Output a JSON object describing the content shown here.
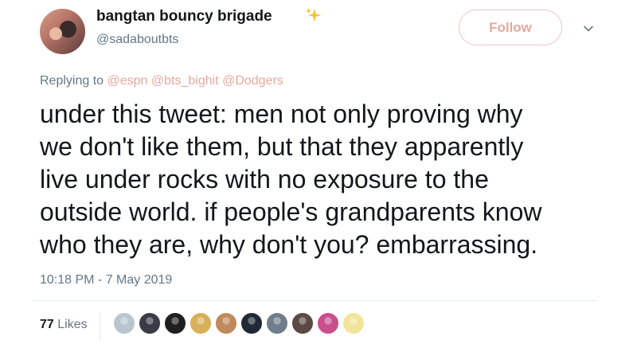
{
  "author": {
    "name": "bangtan bouncy brigade",
    "handle": "@sadaboutbts",
    "avatar_icon": "profile-photo",
    "name_emoji_icon": "sparkles-icon"
  },
  "actions": {
    "follow_label": "Follow",
    "more_icon": "chevron-down-icon"
  },
  "reply": {
    "prefix": "Replying to ",
    "mentions": [
      "@espn",
      "@bts_bighit",
      "@Dodgers"
    ]
  },
  "tweet": {
    "text": "under this tweet: men not only proving why\nwe don't like them, but that they apparently\nlive under rocks with no exposure to the\noutside world.  if people's grandparents know\nwho they are, why don't you? embarrassing."
  },
  "timestamp": "10:18 PM - 7 May 2019",
  "stats": {
    "likes_count": "77",
    "likes_label": "Likes"
  },
  "likers": [
    {
      "icon": "default-avatar",
      "color": "#b9c6d0"
    },
    {
      "icon": "avatar",
      "color": "#3b3b48"
    },
    {
      "icon": "avatar",
      "color": "#1f1f1f"
    },
    {
      "icon": "avatar",
      "color": "#d9b05a"
    },
    {
      "icon": "avatar",
      "color": "#c08a5c"
    },
    {
      "icon": "avatar",
      "color": "#202a36"
    },
    {
      "icon": "avatar",
      "color": "#6f7d8c"
    },
    {
      "icon": "avatar",
      "color": "#5b4a44"
    },
    {
      "icon": "avatar",
      "color": "#c94f8d"
    },
    {
      "icon": "avatar",
      "color": "#f2e59a"
    }
  ],
  "colors": {
    "accent": "#e6a89c",
    "text": "#14171a",
    "secondary": "#657786"
  }
}
